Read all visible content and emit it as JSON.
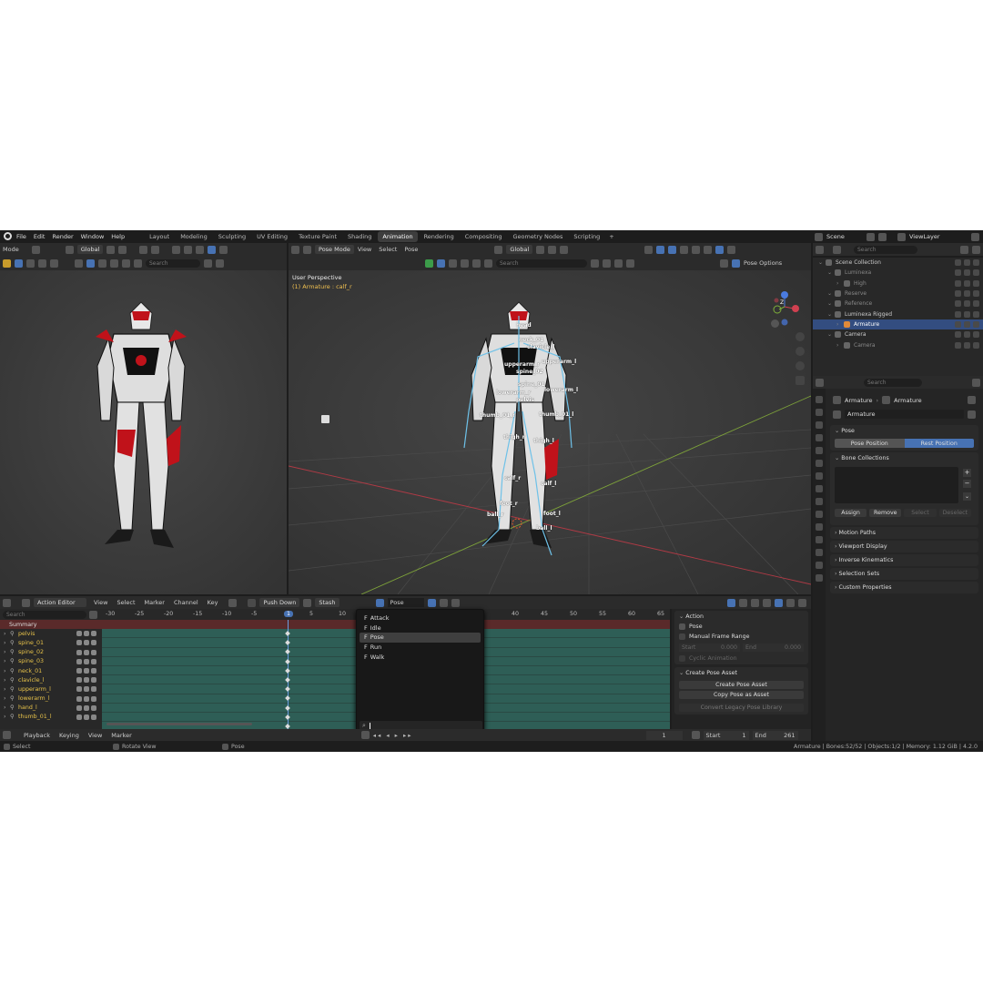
{
  "topbar": {
    "menu": [
      "File",
      "Edit",
      "Render",
      "Window",
      "Help"
    ],
    "workspaces": [
      "Layout",
      "Modeling",
      "Sculpting",
      "UV Editing",
      "Texture Paint",
      "Shading",
      "Animation",
      "Rendering",
      "Compositing",
      "Geometry Nodes",
      "Scripting"
    ],
    "active_workspace": "Animation",
    "add_tab": "+",
    "scene": "Scene",
    "viewlayer": "ViewLayer"
  },
  "left_viewport": {
    "mode": "Mode",
    "orientation": "Global",
    "search_placeholder": "Search"
  },
  "main_viewport": {
    "mode": "Pose Mode",
    "menu": [
      "View",
      "Select",
      "Pose"
    ],
    "orientation": "Global",
    "search_placeholder": "Search",
    "pose_options": "Pose Options",
    "perspective": "User Perspective",
    "active": "(1) Armature : calf_r",
    "bones": [
      {
        "name": "head"
      },
      {
        "name": "neck_01"
      },
      {
        "name": "clavicle_l"
      },
      {
        "name": "upperarm_r"
      },
      {
        "name": "upperarm_l"
      },
      {
        "name": "spine_02"
      },
      {
        "name": "spine_01"
      },
      {
        "name": "lowerarm_r"
      },
      {
        "name": "lowerarm_l"
      },
      {
        "name": "pelvis"
      },
      {
        "name": "thumb_01_r"
      },
      {
        "name": "thumb_01_l"
      },
      {
        "name": "thigh_r"
      },
      {
        "name": "thigh_l"
      },
      {
        "name": "calf_r"
      },
      {
        "name": "calf_l"
      },
      {
        "name": "foot_r"
      },
      {
        "name": "foot_l"
      },
      {
        "name": "ball_r"
      },
      {
        "name": "ball_l"
      }
    ],
    "axes": {
      "z": "Z",
      "y": "Y",
      "x": "X"
    }
  },
  "outliner": {
    "search_placeholder": "Search",
    "items": [
      {
        "label": "Scene Collection",
        "indent": 0,
        "selected": false,
        "dim": false
      },
      {
        "label": "Luminexa",
        "indent": 1,
        "selected": false,
        "dim": true
      },
      {
        "label": "High",
        "indent": 2,
        "selected": false,
        "dim": true
      },
      {
        "label": "Reserve",
        "indent": 1,
        "selected": false,
        "dim": true
      },
      {
        "label": "Reference",
        "indent": 1,
        "selected": false,
        "dim": true
      },
      {
        "label": "Luminexa Rigged",
        "indent": 1,
        "selected": false,
        "dim": false
      },
      {
        "label": "Armature",
        "indent": 2,
        "selected": true,
        "dim": false
      },
      {
        "label": "Camera",
        "indent": 1,
        "selected": false,
        "dim": false
      },
      {
        "label": "Camera",
        "indent": 2,
        "selected": false,
        "dim": true
      }
    ]
  },
  "properties": {
    "search_placeholder": "Search",
    "breadcrumb": [
      "Armature",
      "Armature"
    ],
    "name_field": "Armature",
    "pose_panel": {
      "title": "Pose",
      "pose_position": "Pose Position",
      "rest_position": "Rest Position"
    },
    "bone_collections": {
      "title": "Bone Collections",
      "assign": "Assign",
      "remove": "Remove",
      "select": "Select",
      "deselect": "Deselect"
    },
    "collapsed_panels": [
      "Motion Paths",
      "Viewport Display",
      "Inverse Kinematics",
      "Selection Sets",
      "Custom Properties"
    ]
  },
  "action_editor": {
    "mode": "Action Editor",
    "menu": [
      "View",
      "Select",
      "Marker",
      "Channel",
      "Key"
    ],
    "push_down": "Push Down",
    "stash": "Stash",
    "action_name": "Pose",
    "search_placeholder": "Search",
    "summary": "Summary",
    "channels": [
      "pelvis",
      "spine_01",
      "spine_02",
      "spine_03",
      "neck_01",
      "clavicle_l",
      "upperarm_l",
      "lowerarm_l",
      "hand_l",
      "thumb_01_l"
    ],
    "ruler": [
      "-30",
      "-25",
      "-20",
      "-15",
      "-10",
      "-5",
      "1",
      "5",
      "10",
      "40",
      "45",
      "50",
      "55",
      "60",
      "65"
    ],
    "current_frame": "1",
    "dropdown_items": [
      "Attack",
      "Idle",
      "Pose",
      "Run",
      "Walk"
    ],
    "dropdown_selected": "Pose",
    "dropdown_prefix": "F"
  },
  "action_sidebar": {
    "action_title": "Action",
    "action_name": "Pose",
    "manual_frame_range": "Manual Frame Range",
    "start_label": "Start",
    "start_value": "0.000",
    "end_label": "End",
    "end_value": "0.000",
    "cyclic": "Cyclic Animation",
    "create_pose_asset_title": "Create Pose Asset",
    "create_pose_asset_btn": "Create Pose Asset",
    "copy_pose_btn": "Copy Pose as Asset",
    "convert_btn": "Convert Legacy Pose Library"
  },
  "timeline": {
    "menu": [
      "Playback",
      "Keying",
      "View",
      "Marker"
    ],
    "frame": "1",
    "start_label": "Start",
    "start": "1",
    "end_label": "End",
    "end": "261"
  },
  "statusbar": {
    "select": "Select",
    "rotate": "Rotate View",
    "pose": "Pose",
    "stats": "Armature | Bones:52/52 | Objects:1/2 | Memory: 1.12 GiB | 4.2.0"
  },
  "colors": {
    "accent": "#4772b3",
    "keyframe_bg": "#2e5e56",
    "summary_bg": "#5a2a2a",
    "channel_text": "#e8c34a",
    "viewport": "#3a3a3a"
  }
}
